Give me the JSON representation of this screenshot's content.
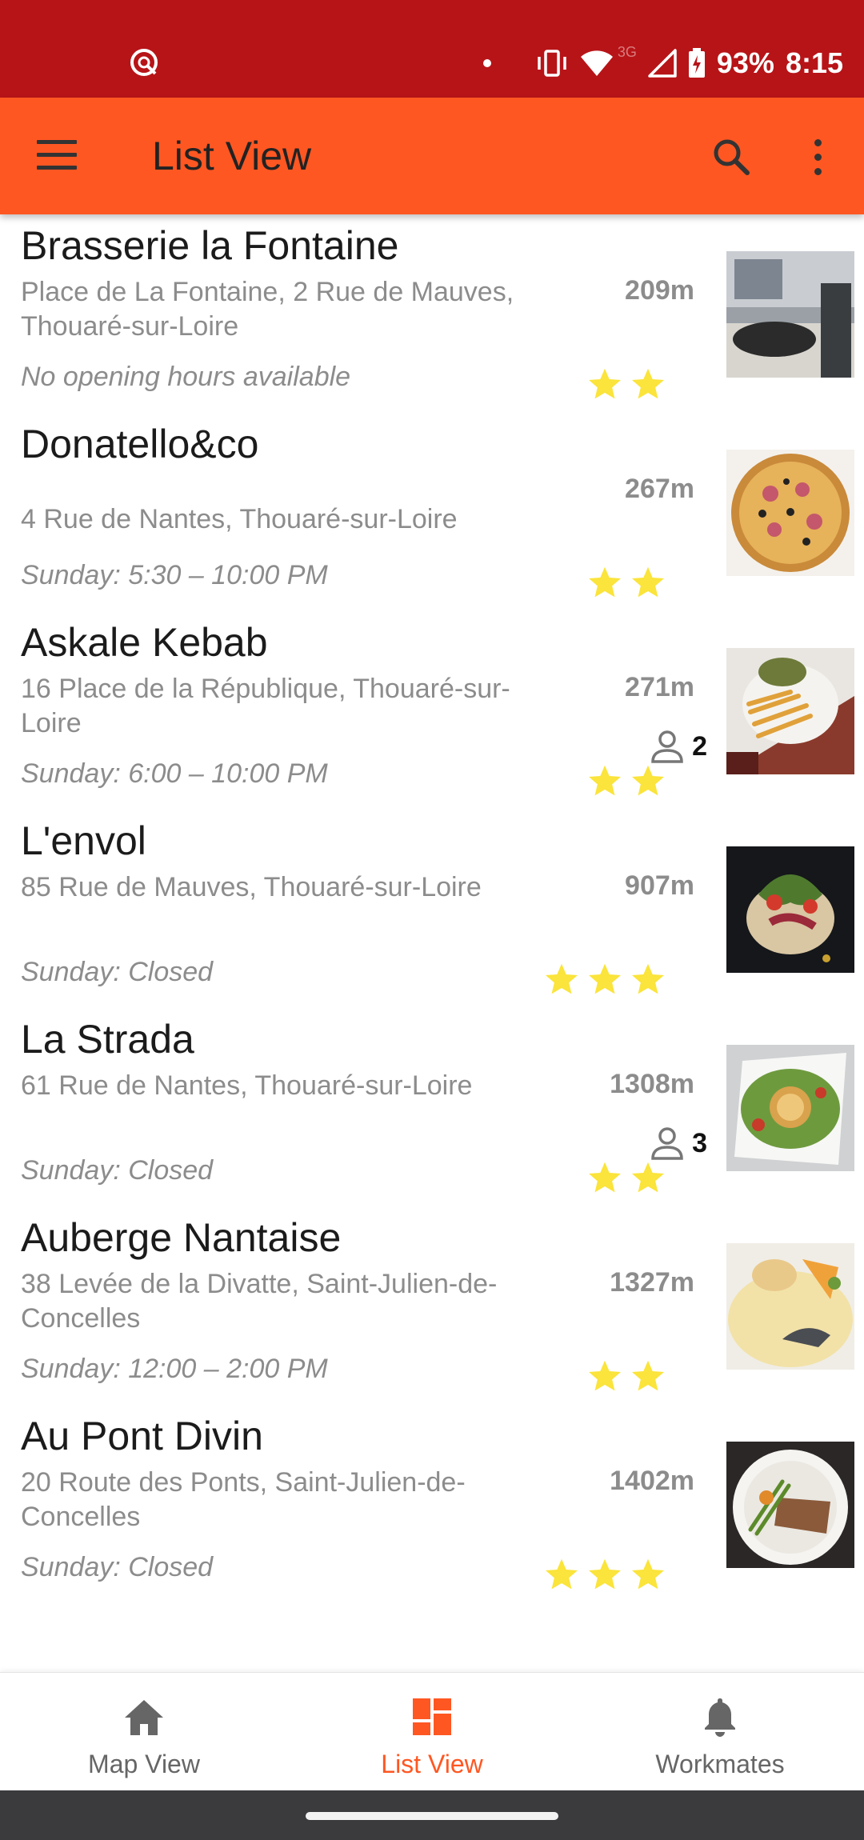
{
  "status_bar": {
    "battery": "93%",
    "time": "8:15",
    "network_type": "3G",
    "icons": [
      "app-notification-icon",
      "dot-icon",
      "vibrate-icon",
      "wifi-icon",
      "signal-icon",
      "battery-icon"
    ]
  },
  "toolbar": {
    "title": "List View",
    "icons": [
      "menu-icon",
      "search-icon",
      "more-vert-icon"
    ],
    "background_color": "#ff5722"
  },
  "restaurants": [
    {
      "name": "Brasserie la Fontaine",
      "address": "Place de La Fontaine, 2 Rue de Mauves, Thouaré-sur-Loire",
      "hours": "No opening hours available",
      "distance": "209m",
      "workmates": null,
      "rating_stars": 2
    },
    {
      "name": "Donatello&co",
      "address": "4 Rue de Nantes, Thouaré-sur-Loire",
      "hours": "Sunday: 5:30 – 10:00 PM",
      "distance": "267m",
      "workmates": null,
      "rating_stars": 2
    },
    {
      "name": "Askale Kebab",
      "address": "16 Place de la République, Thouaré-sur-Loire",
      "hours": "Sunday: 6:00 – 10:00 PM",
      "distance": "271m",
      "workmates": "2",
      "rating_stars": 2
    },
    {
      "name": "L'envol",
      "address": "85 Rue de Mauves, Thouaré-sur-Loire",
      "hours": "Sunday: Closed",
      "distance": "907m",
      "workmates": null,
      "rating_stars": 3
    },
    {
      "name": "La Strada",
      "address": "61 Rue de Nantes, Thouaré-sur-Loire",
      "hours": "Sunday: Closed",
      "distance": "1308m",
      "workmates": "3",
      "rating_stars": 2
    },
    {
      "name": "Auberge Nantaise",
      "address": "38 Levée de la Divatte, Saint-Julien-de-Concelles",
      "hours": "Sunday: 12:00 – 2:00 PM",
      "distance": "1327m",
      "workmates": null,
      "rating_stars": 2
    },
    {
      "name": "Au Pont Divin",
      "address": "20 Route des Ponts, Saint-Julien-de-Concelles",
      "hours": "Sunday: Closed",
      "distance": "1402m",
      "workmates": null,
      "rating_stars": 3
    }
  ],
  "bottom_nav": {
    "items": [
      {
        "label": "Map View",
        "icon": "home-icon",
        "active": false
      },
      {
        "label": "List View",
        "icon": "dashboard-icon",
        "active": true
      },
      {
        "label": "Workmates",
        "icon": "bell-icon",
        "active": false
      }
    ],
    "active_color": "#ff5722",
    "inactive_color": "#666666"
  },
  "colors": {
    "status_bar": "#b71418",
    "star": "#fbe43b",
    "secondary_text": "#8c8c8c"
  }
}
